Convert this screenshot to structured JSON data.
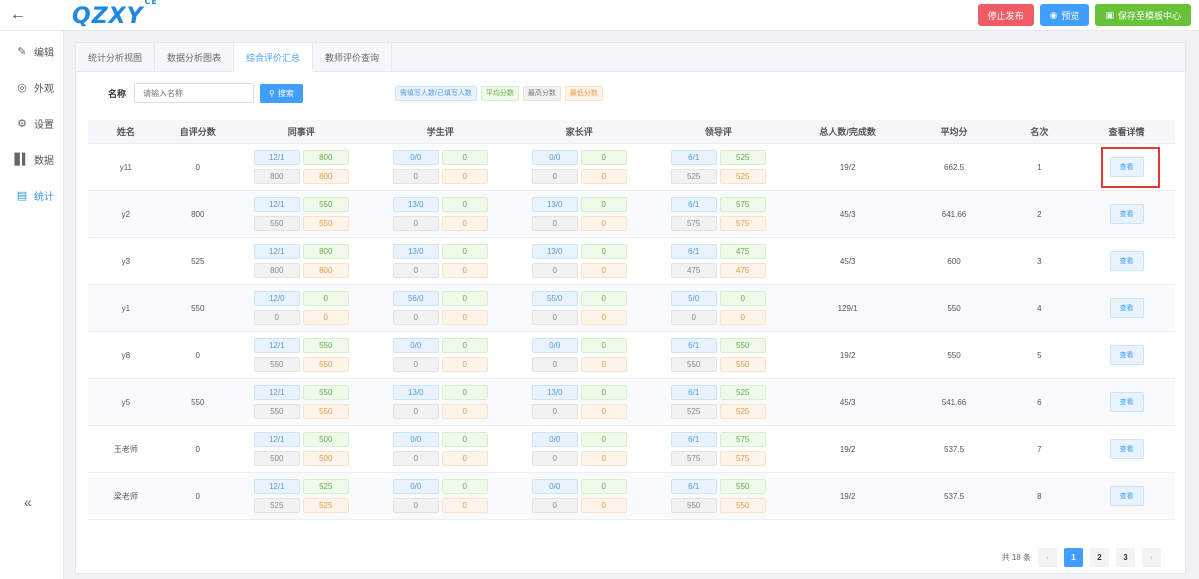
{
  "topbar": {
    "back_icon": "arrow-left-icon",
    "logo_text": "QZXY",
    "logo_sup": "CE",
    "stop_label": "停止发布",
    "preview_label": "预览",
    "save_template_label": "保存至模板中心",
    "colors": {
      "red": "#ef5d64",
      "blue": "#409eff",
      "green": "#67c23a"
    }
  },
  "sidebar": {
    "items": [
      {
        "label": "编辑",
        "icon": "pencil-icon"
      },
      {
        "label": "外观",
        "icon": "eye-icon"
      },
      {
        "label": "设置",
        "icon": "gear-icon"
      },
      {
        "label": "数据",
        "icon": "bar-chart-icon"
      },
      {
        "label": "统计",
        "icon": "stats-icon",
        "active": true
      }
    ],
    "collapse_icon": "double-chevron-left-icon"
  },
  "tabs": [
    "统计分析视图",
    "数据分析图表",
    "综合评价汇总",
    "教师评价查询"
  ],
  "active_tab": 2,
  "search": {
    "label": "名称",
    "placeholder": "请输入名称",
    "button_label": "搜索"
  },
  "legend": {
    "blue": "需填写人数/已填写人数",
    "green": "平均分数",
    "gray": "最高分数",
    "orange": "最低分数"
  },
  "table": {
    "headers": [
      "姓名",
      "自评分数",
      "同事评",
      "学生评",
      "家长评",
      "领导评",
      "总人数/完成数",
      "平均分",
      "名次",
      "查看详情"
    ],
    "view_label": "查看",
    "rows": [
      {
        "name": "y11",
        "self": "0",
        "colleague": [
          "12/1",
          "800",
          "800",
          "800"
        ],
        "student": [
          "0/0",
          "0",
          "0",
          "0"
        ],
        "parent": [
          "0/0",
          "0",
          "0",
          "0"
        ],
        "leader": [
          "6/1",
          "525",
          "525",
          "525"
        ],
        "total": "19/2",
        "avg": "662.5",
        "rank": "1"
      },
      {
        "name": "y2",
        "self": "800",
        "colleague": [
          "12/1",
          "550",
          "550",
          "550"
        ],
        "student": [
          "13/0",
          "0",
          "0",
          "0"
        ],
        "parent": [
          "13/0",
          "0",
          "0",
          "0"
        ],
        "leader": [
          "6/1",
          "575",
          "575",
          "575"
        ],
        "total": "45/3",
        "avg": "641.66",
        "rank": "2"
      },
      {
        "name": "y3",
        "self": "525",
        "colleague": [
          "12/1",
          "800",
          "800",
          "800"
        ],
        "student": [
          "13/0",
          "0",
          "0",
          "0"
        ],
        "parent": [
          "13/0",
          "0",
          "0",
          "0"
        ],
        "leader": [
          "6/1",
          "475",
          "475",
          "475"
        ],
        "total": "45/3",
        "avg": "600",
        "rank": "3"
      },
      {
        "name": "y1",
        "self": "550",
        "colleague": [
          "12/0",
          "0",
          "0",
          "0"
        ],
        "student": [
          "56/0",
          "0",
          "0",
          "0"
        ],
        "parent": [
          "55/0",
          "0",
          "0",
          "0"
        ],
        "leader": [
          "5/0",
          "0",
          "0",
          "0"
        ],
        "total": "129/1",
        "avg": "550",
        "rank": "4"
      },
      {
        "name": "y8",
        "self": "0",
        "colleague": [
          "12/1",
          "550",
          "550",
          "550"
        ],
        "student": [
          "0/0",
          "0",
          "0",
          "0"
        ],
        "parent": [
          "0/0",
          "0",
          "0",
          "0"
        ],
        "leader": [
          "6/1",
          "550",
          "550",
          "550"
        ],
        "total": "19/2",
        "avg": "550",
        "rank": "5"
      },
      {
        "name": "y5",
        "self": "550",
        "colleague": [
          "12/1",
          "550",
          "550",
          "550"
        ],
        "student": [
          "13/0",
          "0",
          "0",
          "0"
        ],
        "parent": [
          "13/0",
          "0",
          "0",
          "0"
        ],
        "leader": [
          "6/1",
          "525",
          "525",
          "525"
        ],
        "total": "45/3",
        "avg": "541.66",
        "rank": "6"
      },
      {
        "name": "王老师",
        "self": "0",
        "colleague": [
          "12/1",
          "500",
          "500",
          "500"
        ],
        "student": [
          "0/0",
          "0",
          "0",
          "0"
        ],
        "parent": [
          "0/0",
          "0",
          "0",
          "0"
        ],
        "leader": [
          "6/1",
          "575",
          "575",
          "575"
        ],
        "total": "19/2",
        "avg": "537.5",
        "rank": "7"
      },
      {
        "name": "梁老师",
        "self": "0",
        "colleague": [
          "12/1",
          "525",
          "525",
          "525"
        ],
        "student": [
          "0/0",
          "0",
          "0",
          "0"
        ],
        "parent": [
          "0/0",
          "0",
          "0",
          "0"
        ],
        "leader": [
          "6/1",
          "550",
          "550",
          "550"
        ],
        "total": "19/2",
        "avg": "537.5",
        "rank": "8"
      }
    ]
  },
  "pagination": {
    "total_text": "共 18 条",
    "pages": [
      "1",
      "2",
      "3"
    ],
    "current": "1",
    "prev_icon": "chevron-left-icon",
    "next_icon": "chevron-right-icon"
  }
}
